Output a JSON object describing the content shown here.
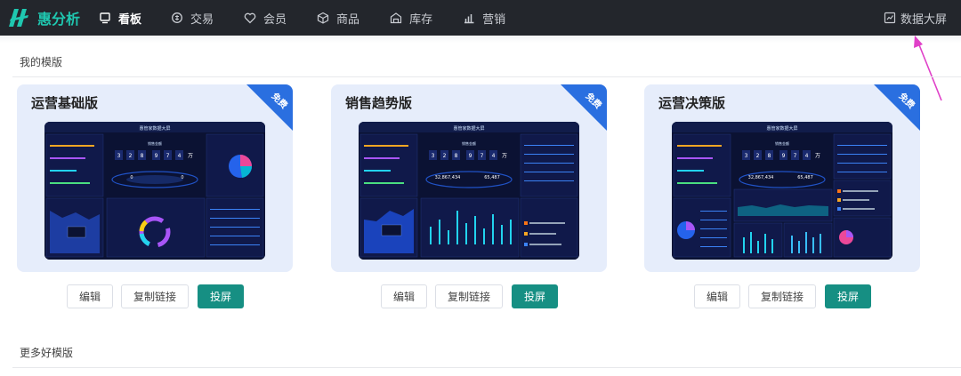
{
  "app": {
    "logo_text": "惠分析"
  },
  "nav": {
    "items": [
      {
        "label": "看板",
        "icon": "dashboard-icon",
        "active": true
      },
      {
        "label": "交易",
        "icon": "transaction-icon",
        "active": false
      },
      {
        "label": "会员",
        "icon": "member-icon",
        "active": false
      },
      {
        "label": "商品",
        "icon": "product-icon",
        "active": false
      },
      {
        "label": "库存",
        "icon": "inventory-icon",
        "active": false
      },
      {
        "label": "营销",
        "icon": "marketing-icon",
        "active": false
      }
    ],
    "screen_link": "数据大屏"
  },
  "sections": {
    "mine": "我的模版",
    "more": "更多好模版"
  },
  "templates": [
    {
      "title": "运营基础版",
      "badge": "免费",
      "actions": [
        "编辑",
        "复制链接",
        "投屏"
      ]
    },
    {
      "title": "销售趋势版",
      "badge": "免费",
      "actions": [
        "编辑",
        "复制链接",
        "投屏"
      ]
    },
    {
      "title": "运营决策版",
      "badge": "免费",
      "actions": [
        "编辑",
        "复制链接",
        "投屏"
      ]
    }
  ],
  "preview": {
    "screen_title": "惠管家数据大屏",
    "counter_label": "销售金额",
    "digits": [
      "3",
      "2",
      "8",
      "9",
      "7",
      "4"
    ],
    "unit": "万",
    "stat_a": "32,867,434",
    "stat_b": "65,487",
    "stat_zero_a": "0",
    "stat_zero_b": "0"
  },
  "colors": {
    "topbar": "#23262c",
    "accent": "#168f83",
    "logo": "#1fc7b0",
    "card_bg": "#e6edfb",
    "ribbon": "#2a6fe0",
    "annotation_arrow": "#e040c8"
  }
}
